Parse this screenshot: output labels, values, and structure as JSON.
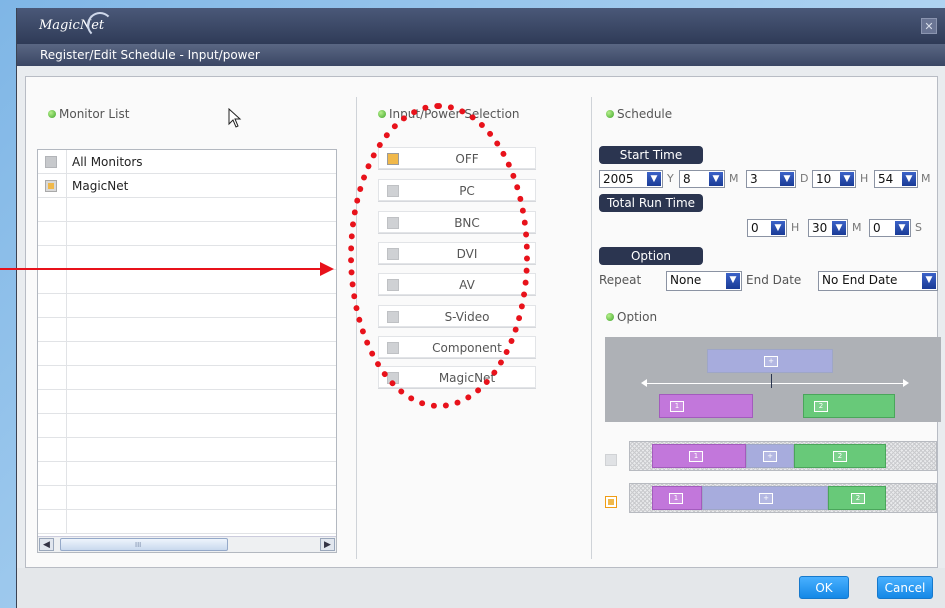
{
  "window": {
    "logo": "MagicNet",
    "close_glyph": "✕",
    "subtitle": "Register/Edit Schedule - Input/power"
  },
  "monitor_list": {
    "title": "Monitor List",
    "items": [
      {
        "label": "All Monitors",
        "selected": false
      },
      {
        "label": "MagicNet",
        "selected": true
      }
    ],
    "scroll_grip": "III"
  },
  "input_power": {
    "title": "Input/Power Selection",
    "options": [
      {
        "label": "OFF",
        "checked": true
      },
      {
        "label": "PC",
        "checked": false
      },
      {
        "label": "BNC",
        "checked": false
      },
      {
        "label": "DVI",
        "checked": false
      },
      {
        "label": "AV",
        "checked": false
      },
      {
        "label": "S-Video",
        "checked": false
      },
      {
        "label": "Component",
        "checked": false
      },
      {
        "label": "MagicNet",
        "checked": false
      }
    ]
  },
  "schedule": {
    "title": "Schedule",
    "start_time_label": "Start Time",
    "start": {
      "year": "2005",
      "year_unit": "Y",
      "month": "8",
      "month_unit": "M",
      "day": "3",
      "day_unit": "D",
      "hour": "10",
      "hour_unit": "H",
      "minute": "54",
      "minute_unit": "M"
    },
    "total_run_time_label": "Total Run Time",
    "run": {
      "hours": "0",
      "hours_unit": "H",
      "minutes": "30",
      "minutes_unit": "M",
      "seconds": "0",
      "seconds_unit": "S"
    },
    "option_label": "Option",
    "repeat_label": "Repeat",
    "repeat_value": "None",
    "end_date_label": "End Date",
    "end_date_value": "No End Date",
    "option_section_title": "Option",
    "folder_plus": "+",
    "folder_one": "1",
    "folder_two": "2"
  },
  "footer": {
    "ok": "OK",
    "cancel": "Cancel"
  },
  "colors": {
    "annotation": "#e8121b",
    "accent": "#1488e6",
    "header": "#2f3b57"
  },
  "icons": {
    "dropdown": "chevron-down-icon",
    "status": "green-dot-icon",
    "close": "close-icon"
  },
  "dropdown_glyph": "▼",
  "left_arrow": "◀",
  "right_arrow": "▶"
}
